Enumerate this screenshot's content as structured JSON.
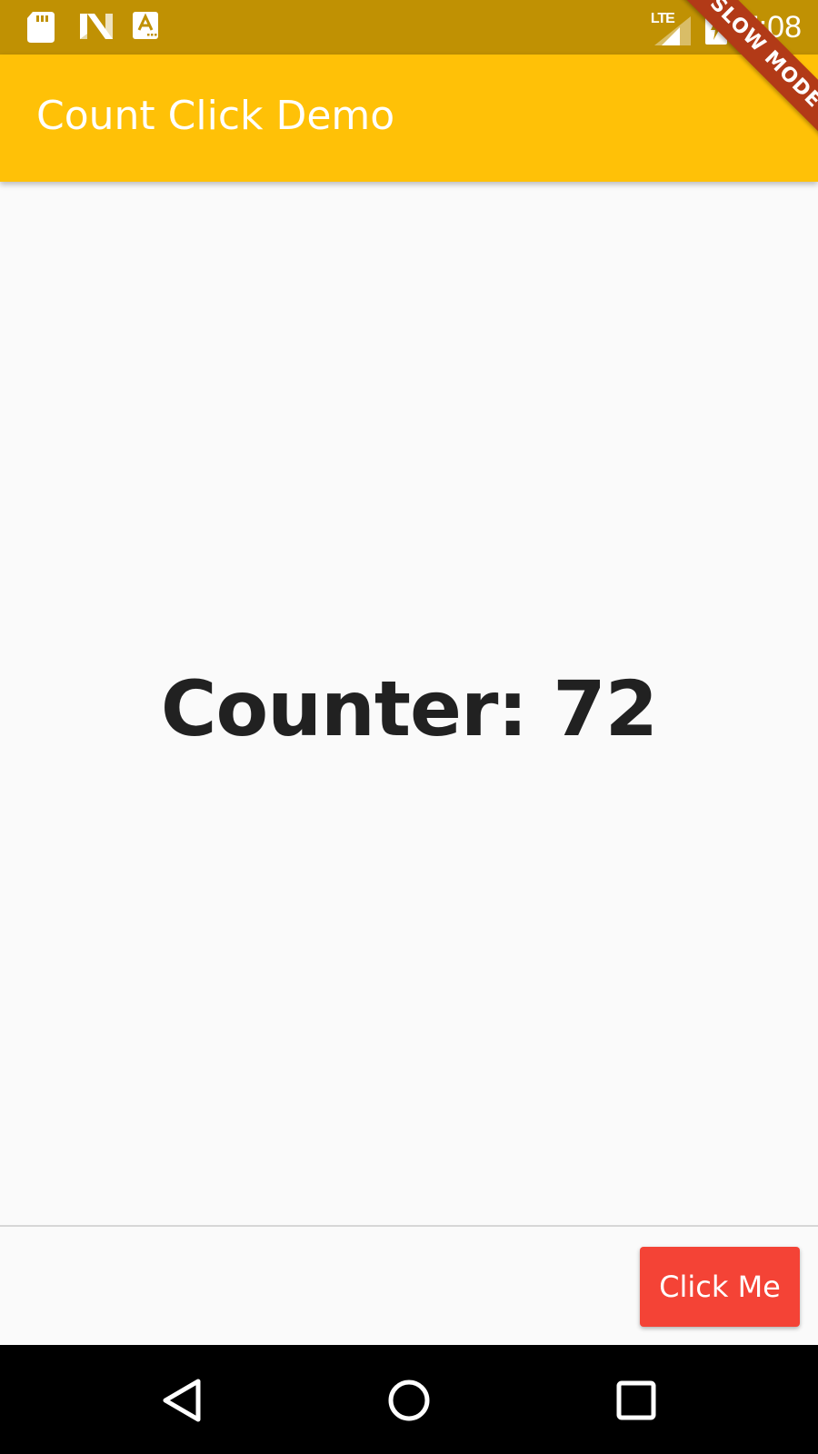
{
  "status_bar": {
    "left_icons": [
      "sd-card-icon",
      "n-logo-icon",
      "a-badge-icon"
    ],
    "network": "LTE",
    "time": "7:08",
    "right_icons": [
      "signal-icon",
      "battery-charging-icon"
    ]
  },
  "debug_banner": {
    "text": "SLOW MODE",
    "color": "#b23a17"
  },
  "app_bar": {
    "title": "Count Click Demo",
    "color": "#ffc107"
  },
  "main": {
    "counter_text": "Counter: 72"
  },
  "bottom_bar": {
    "button_label": "Click Me",
    "button_color": "#f44336"
  },
  "nav_bar": {
    "icons": [
      "back-icon",
      "home-icon",
      "recent-apps-icon"
    ]
  },
  "colors": {
    "status_bar": "#c09103",
    "background": "#fafafa",
    "text": "#212121"
  }
}
